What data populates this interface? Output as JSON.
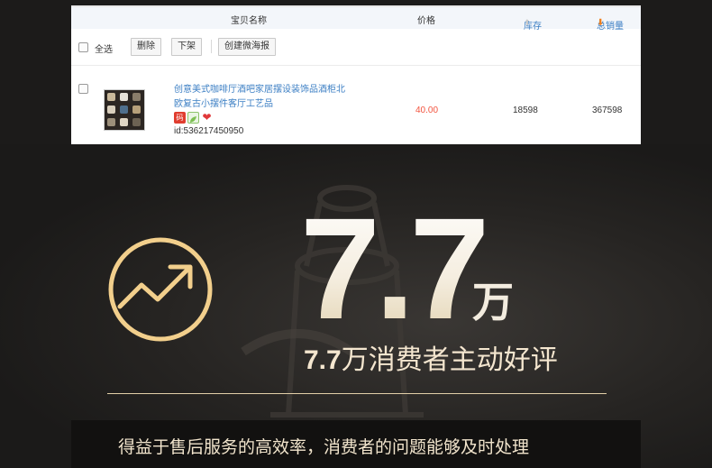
{
  "table": {
    "headers": {
      "name": "宝贝名称",
      "price": "价格",
      "stock": "库存",
      "sales": "总销量"
    },
    "toolbar": {
      "select_all": "全选",
      "delete": "删除",
      "offline": "下架",
      "share": "创建微海报"
    },
    "row": {
      "title": "创意美式咖啡厅酒吧家居摆设装饰品酒柜北欧复古小摆件客厅工艺品",
      "badge_text": "码",
      "id": "id:536217450950",
      "price": "40.00",
      "stock": "18598",
      "sales": "367598"
    }
  },
  "banner": {
    "big_number": "7.7",
    "big_unit": "万",
    "subtitle_number": "7.7",
    "subtitle_text": "万消费者主动好评",
    "caption": "得益于售后服务的高效率，消费者的问题能够及时处理",
    "accent_color": "#f2cf8c",
    "price_color": "#f2543f",
    "link_color": "#3c7fc4"
  },
  "icons": [
    "sort-up-icon",
    "sort-down-icon",
    "trend-up-icon",
    "heart-icon",
    "leaf-icon"
  ]
}
